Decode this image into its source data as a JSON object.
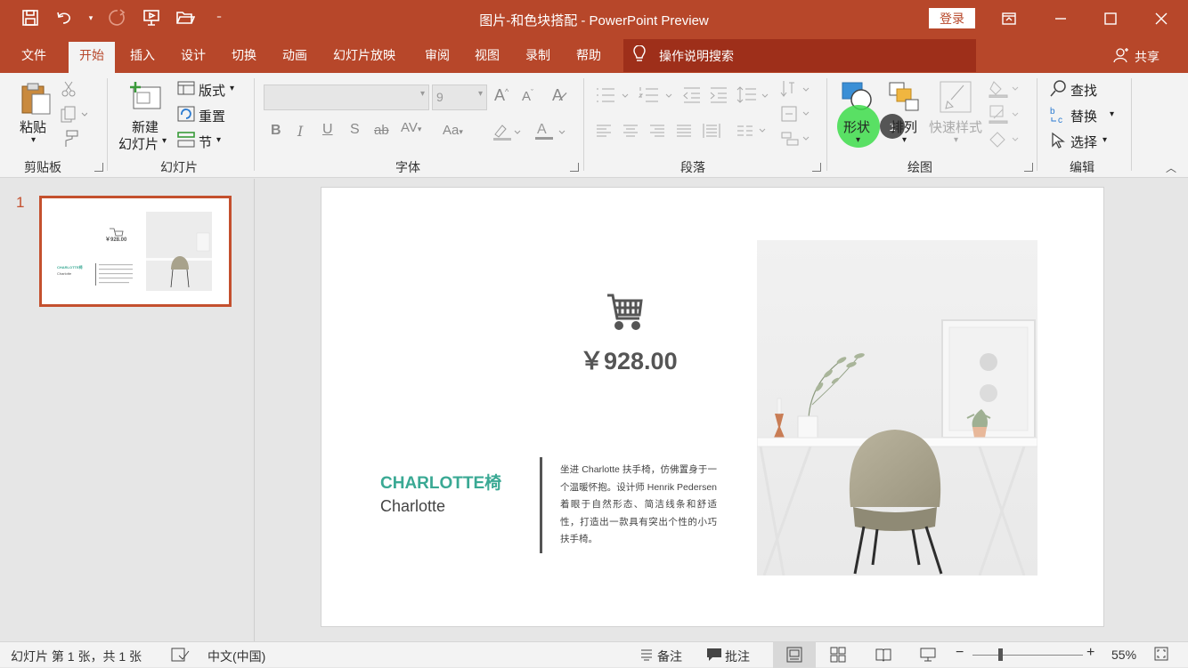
{
  "window": {
    "title": "图片-和色块搭配  -  PowerPoint Preview",
    "login": "登录"
  },
  "tabs": [
    "文件",
    "开始",
    "插入",
    "设计",
    "切换",
    "动画",
    "幻灯片放映",
    "审阅",
    "视图",
    "录制",
    "帮助"
  ],
  "active_tab": "开始",
  "tell_me": "操作说明搜索",
  "share": "共享",
  "ribbon": {
    "clipboard": {
      "paste": "粘贴",
      "label": "剪贴板"
    },
    "slides": {
      "new_slide_1": "新建",
      "new_slide_2": "幻灯片",
      "layout": "版式",
      "reset": "重置",
      "section": "节",
      "label": "幻灯片"
    },
    "font": {
      "size": "9",
      "label": "字体"
    },
    "paragraph": {
      "label": "段落"
    },
    "drawing": {
      "shapes": "形状",
      "arrange": "排列",
      "quick_styles": "快速样式",
      "label": "绘图",
      "badge": "1"
    },
    "editing": {
      "find": "查找",
      "replace": "替换",
      "select": "选择",
      "label": "编辑"
    }
  },
  "slide_pane": {
    "slide_number": "1"
  },
  "slide": {
    "price": "￥928.00",
    "title": "CHARLOTTE椅",
    "subtitle": "Charlotte",
    "description": "坐进 Charlotte 扶手椅，仿佛置身于一个温暖怀抱。设计师 Henrik Pedersen 着眼于自然形态、简洁线条和舒适性，打造出一款具有突出个性的小巧扶手椅。"
  },
  "status": {
    "slide_info": "幻灯片 第 1 张，共 1 张",
    "language": "中文(中国)",
    "notes": "备注",
    "comments": "批注",
    "zoom": "55%"
  },
  "colors": {
    "accent": "#b7472a",
    "teal": "#3aa994",
    "highlight": "#3ddc4a"
  }
}
